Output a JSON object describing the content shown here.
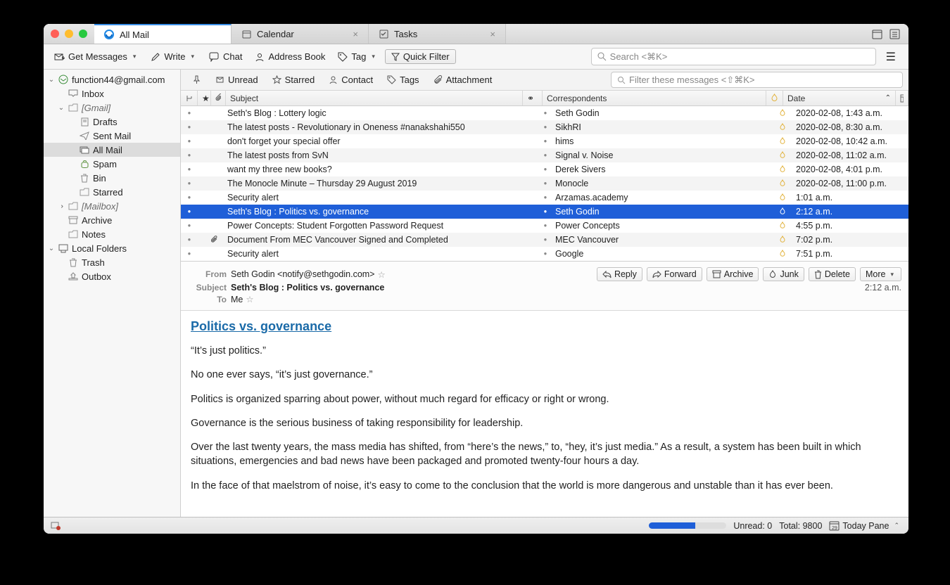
{
  "window": {
    "tabs": [
      {
        "label": "All Mail",
        "active": true,
        "icon": "thunderbird"
      },
      {
        "label": "Calendar",
        "active": false,
        "icon": "calendar",
        "closable": true
      },
      {
        "label": "Tasks",
        "active": false,
        "icon": "tasks",
        "closable": true
      }
    ]
  },
  "toolbar": {
    "get_messages": "Get Messages",
    "write": "Write",
    "chat": "Chat",
    "address_book": "Address Book",
    "tag": "Tag",
    "quick_filter": "Quick Filter",
    "search_placeholder": "Search <⌘K>"
  },
  "sidebar": {
    "account": "function44@gmail.com",
    "inbox": "Inbox",
    "gmail_label": "[Gmail]",
    "drafts": "Drafts",
    "sent": "Sent Mail",
    "allmail": "All Mail",
    "spam": "Spam",
    "bin": "Bin",
    "starred": "Starred",
    "mailbox": "[Mailbox]",
    "archive": "Archive",
    "notes": "Notes",
    "local": "Local Folders",
    "trash": "Trash",
    "outbox": "Outbox"
  },
  "filterbar": {
    "unread": "Unread",
    "starred": "Starred",
    "contact": "Contact",
    "tags": "Tags",
    "attachment": "Attachment",
    "filter_placeholder": "Filter these messages <⇧⌘K>"
  },
  "columns": {
    "subject": "Subject",
    "correspondents": "Correspondents",
    "date": "Date"
  },
  "messages": [
    {
      "subject": "Seth's Blog : Lottery logic",
      "corr": "Seth Godin",
      "date": "2020-02-08, 1:43 a.m."
    },
    {
      "subject": "The latest posts - Revolutionary in Oneness #nanakshahi550",
      "corr": "SikhRI",
      "date": "2020-02-08, 8:30 a.m."
    },
    {
      "subject": "don't forget your special offer",
      "corr": "hims",
      "date": "2020-02-08, 10:42 a.m."
    },
    {
      "subject": "The latest posts from SvN",
      "corr": "Signal v. Noise",
      "date": "2020-02-08, 11:02 a.m."
    },
    {
      "subject": "want my three new books?",
      "corr": "Derek Sivers",
      "date": "2020-02-08, 4:01 p.m."
    },
    {
      "subject": "The Monocle Minute – Thursday 29 August 2019",
      "corr": "Monocle",
      "date": "2020-02-08, 11:00 p.m."
    },
    {
      "subject": "Security alert",
      "corr": "Arzamas.academy",
      "date": "1:01 a.m."
    },
    {
      "subject": "Seth's Blog : Politics vs. governance",
      "corr": "Seth Godin",
      "date": "2:12 a.m.",
      "selected": true
    },
    {
      "subject": "Power Concepts: Student Forgotten Password Request",
      "corr": "Power Concepts",
      "date": "4:55 p.m."
    },
    {
      "subject": "Document From MEC Vancouver Signed and Completed",
      "corr": "MEC Vancouver",
      "date": "7:02 p.m.",
      "attach": true
    },
    {
      "subject": "Security alert",
      "corr": "Google",
      "date": "7:51 p.m."
    }
  ],
  "preview": {
    "from_label": "From",
    "from": "Seth Godin <notify@sethgodin.com>",
    "subject_label": "Subject",
    "subject": "Seth's Blog : Politics vs. governance",
    "to_label": "To",
    "to": "Me",
    "time": "2:12 a.m.",
    "title": "Politics vs. governance",
    "paras": [
      "“It’s just politics.”",
      "No one ever says, “it’s just governance.”",
      "Politics is organized sparring about power, without much regard for efficacy or right or wrong.",
      "Governance is the serious business of taking responsibility for leadership.",
      "Over the last twenty years, the mass media has shifted, from “here’s the news,” to, “hey, it’s just media.” As a result, a system has been built in which situations, emergencies and bad news have been packaged and promoted twenty-four hours a day.",
      "In the face of that maelstrom of noise, it’s easy to come to the conclusion that the world is more dangerous and unstable than it has ever been."
    ],
    "actions": {
      "reply": "Reply",
      "forward": "Forward",
      "archive": "Archive",
      "junk": "Junk",
      "delete": "Delete",
      "more": "More"
    }
  },
  "status": {
    "unread": "Unread: 0",
    "total": "Total: 9800",
    "today_pane": "Today Pane"
  }
}
